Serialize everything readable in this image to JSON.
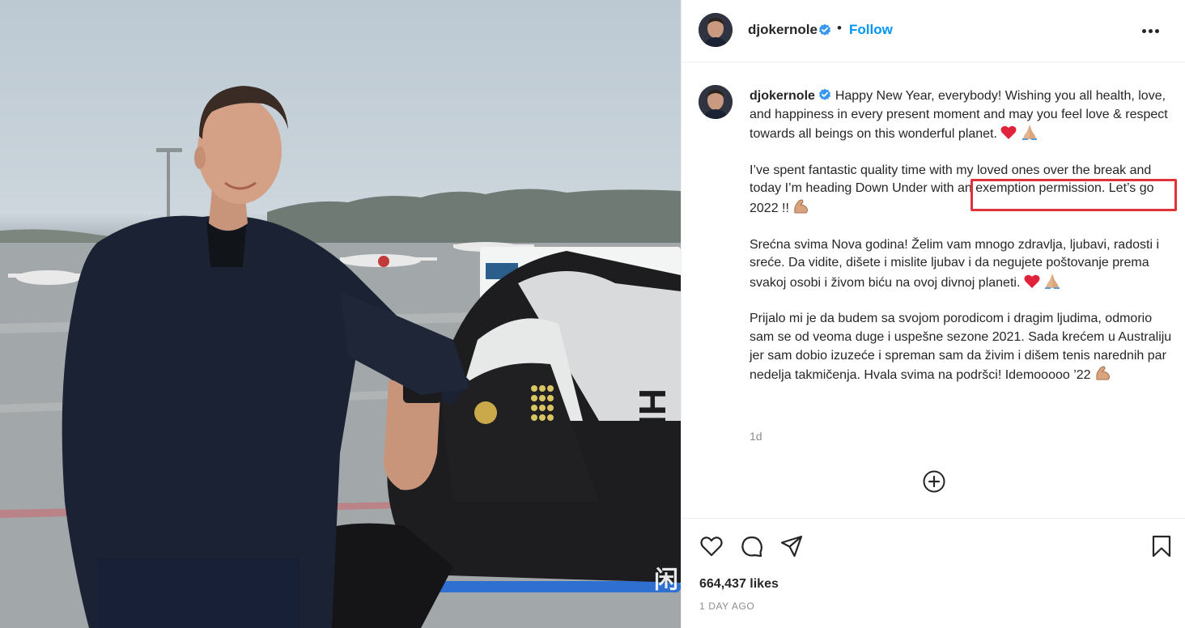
{
  "post": {
    "username": "djokernole",
    "follow_label": "Follow",
    "separator": "•",
    "caption_user": "djokernole",
    "caption_paragraphs": [
      "Happy New Year, everybody! Wishing you all health, love, and happiness in every present moment and may you feel love & respect towards all beings on this wonderful planet.",
      "I’ve spent fantastic quality time with my loved ones over the break and today I’m heading Down Under with an exemption permission. Let’s go 2022 !!",
      "Srećna svima Nova godina! Želim vam mnogo zdravlja, ljubavi, radosti i sreće. Da vidite, dišete i mislite ljubav i da negujete poštovanje prema svakoj osobi i živom biću na ovoj divnoj planeti.",
      "Prijalo mi je da budem sa svojom porodicom i dragim ljudima, odmorio sam se od veoma duge i uspešne sezone 2021. Sada krećem u Australiju jer sam dobio izuzeće i spreman sam da živim i dišem tenis narednih par nedelja takmičenja. Hvala svima na podršci! Idemooooo ’22"
    ],
    "time_short": "1d",
    "likes": "664,437 likes",
    "time_long": "1 DAY AGO"
  },
  "photo": {
    "bag_brand": "HEAD",
    "watermark": "闲"
  },
  "icons": {
    "verified": "verified-badge-icon",
    "more": "more-options-icon",
    "add_comment": "add-comment-icon",
    "like": "heart-icon",
    "comment": "comment-icon",
    "share": "share-icon",
    "save": "bookmark-icon"
  },
  "colors": {
    "link_blue": "#0095f6",
    "verified_blue": "#3897f0",
    "highlight_red": "#e0323a",
    "text": "#262626",
    "muted": "#8e8e8e"
  }
}
